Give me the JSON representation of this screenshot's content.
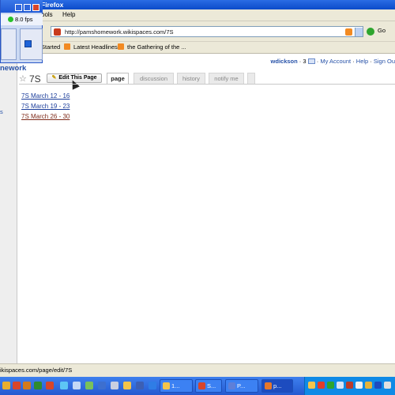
{
  "window": {
    "title": "Firefox"
  },
  "menu": {
    "tools": "ools",
    "help": "Help"
  },
  "address": {
    "url": "http://pamshomework.wikispaces.com/7S",
    "go_label": "Go"
  },
  "bookmarks": {
    "started": "Started",
    "latest_headlines": "Latest Headlines",
    "gathering": "the Gathering of the ..."
  },
  "recorder": {
    "fps": "8.0 fps"
  },
  "site": {
    "title": "nework",
    "side_link": "s"
  },
  "userbar": {
    "user": "wdickson",
    "mail_count": "3",
    "my_account": "My Account",
    "help": "Help",
    "sign_out": "Sign Ou"
  },
  "page": {
    "name": "7S",
    "edit_button": "Edit This Page",
    "tabs": [
      "page",
      "discussion",
      "history",
      "notify me"
    ]
  },
  "links": [
    "7S March 12 - 16",
    "7S March 19 - 23",
    "7S March 26 - 30"
  ],
  "status": {
    "text": "ikispaces.com/page/edit/7S"
  },
  "taskbar": {
    "task1": "1...",
    "task2": "S...",
    "task3": "P...",
    "task4": "p..."
  },
  "colors": {
    "link": "#1b3d9a",
    "visited_link": "#7e2b1a",
    "site_title": "#2651a8",
    "taskbar": "#2459d0"
  }
}
